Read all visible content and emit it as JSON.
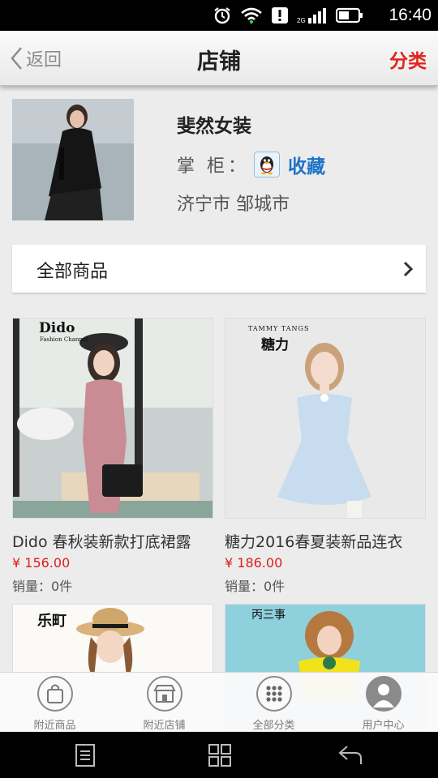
{
  "status": {
    "time": "16:40",
    "network": "2G"
  },
  "header": {
    "back_label": "返回",
    "title": "店铺",
    "category_label": "分类"
  },
  "shop": {
    "name": "斐然女装",
    "keeper_label": "掌 柜：",
    "favorite_label": "收藏",
    "location": "济宁市 邹城市"
  },
  "all_goods": {
    "label": "全部商品"
  },
  "products": [
    {
      "brand": "Dido",
      "brand_sub": "Fashion Channel",
      "title": "Dido 春秋装新款打底裙露",
      "price": "¥ 156.00",
      "sales": "销量：0件"
    },
    {
      "brand": "TAMMY TANGS",
      "brand_sub": "糖力",
      "title": "糖力2016春夏装新品连衣",
      "price": "¥ 186.00",
      "sales": "销量：0件"
    },
    {
      "brand": "乐町",
      "brand_sub": "",
      "title": "",
      "price": "",
      "sales": ""
    },
    {
      "brand": "丙三事",
      "brand_sub": "",
      "title": "",
      "price": "",
      "sales": ""
    }
  ],
  "bottom_nav": [
    {
      "label": "附近商品",
      "icon": "shopping-bag-icon"
    },
    {
      "label": "附近店铺",
      "icon": "store-icon"
    },
    {
      "label": "全部分类",
      "icon": "grid-dots-icon"
    },
    {
      "label": "用户中心",
      "icon": "user-icon"
    }
  ]
}
